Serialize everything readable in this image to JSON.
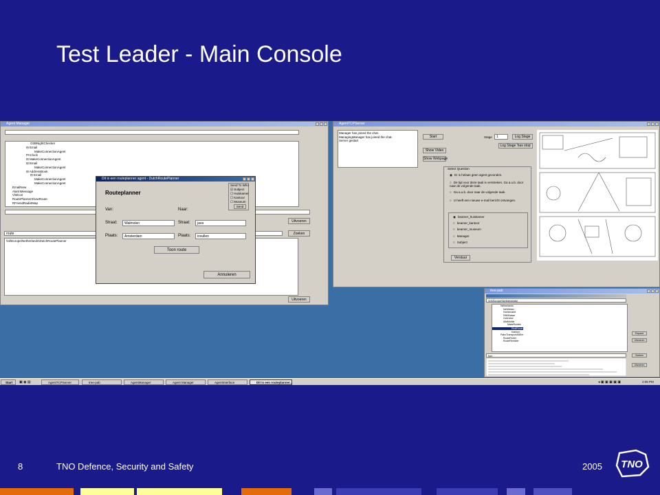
{
  "slide": {
    "title": "Test Leader - Main Console",
    "page_number": "8",
    "footer": "TNO Defence, Security and Safety",
    "year": "2005",
    "logo_text": "TNO"
  },
  "colors": {
    "background": "#1a1a8a",
    "desktop": "#3a6ea5",
    "strip": [
      "#e36c0a",
      "#ffff99",
      "#ffff99",
      "#e36c0a",
      "#6a6ad0",
      "#3c3cb4",
      "#3c3cb4",
      "#6a6ad0",
      "#5050c0"
    ]
  },
  "agent_manager": {
    "title": "Agent Manager",
    "tree": [
      "O2BNightChecker",
      "⊟ Email",
      "MakeConnectionAgent",
      "PAClock",
      "⊟ MakeConnectionAgent",
      "⊟ Email",
      "MakeConnectionAgent",
      "⊟ AddressBook",
      "⊟ Email",
      "MakeConnectionAgent",
      "MakeConnectionAgent",
      "EmailNew",
      "AlarmMessage",
      "VisEcar",
      "RoutePlannerShowRoute",
      "RFriendRadarMap"
    ],
    "route_input": "route",
    "result": "\\\\nl\\Europe\\Netherlands\\DutchRoutePlanner",
    "btn_uitvoeren": "Uitvoeren",
    "btn_zoeken": "Zoeken",
    "btn_uitvoeren2": "Uitvoeren"
  },
  "routeplanner": {
    "title": "Dit is een routeplanner agent - DutchRoutePlanner",
    "heading": "Routeplanner",
    "send_to_who": "Send To Who",
    "checks": [
      "Subject",
      "Huiskamer",
      "Kantoor",
      "Museum"
    ],
    "send": "Send",
    "van": "Van:",
    "naar": "Naar:",
    "straat": "Straat:",
    "plaats": "Plaats:",
    "van_straat": "Walmolen",
    "van_plaats": "Amsterdam",
    "naar_straat": "java",
    "naar_plaats": "invullen",
    "toon_route": "Toon route",
    "annuleren": "Annuleren"
  },
  "tcp_planner": {
    "title": "AgentTCPServer",
    "chat": [
      "Manager has joined the chat.",
      "ManagingManager has joined the chat.",
      "Server gestart"
    ],
    "start": "Start",
    "stage_label": "Stage",
    "stage_value": "1",
    "log_stage": "Log Stage",
    "log_stage_stop": "Log Stage 'has stop'",
    "show_video": "Show Video",
    "show_webpage": "Show Webpage",
    "select_question": "Select Question",
    "questions": [
      "Er is helaas geen agent gevonden.",
      "De tijd voor deze taak is verstreken. Ga a.u.b. door naar de volgende taak.",
      "Ga a.u.b. door naar de volgende taak.",
      "U heeft een nieuwe e-mail bericht ontvangen."
    ],
    "targets": [
      "beamer_huiskamer",
      "beamer_kantoor",
      "beamer_museum",
      "Manager",
      "Subject"
    ],
    "verstuur": "Verstuur"
  },
  "tree_panel": {
    "title": "tree-pab",
    "path": "\\\\nl\\Europe\\Netherlands\\",
    "items": [
      "Netherlands",
      "NetWeken",
      "Homemarkt",
      "PABKlasse",
      "Overview",
      "AlfaMobile",
      "MakeRoutes",
      "RealRoute",
      "Kantoor",
      "PatroTransportABEer",
      "RouteFinder",
      "RouteRemider"
    ],
    "expand": "Expand",
    "uitvoeren": "Uitvoeren",
    "zoeken": "Zoeken",
    "uitvoeren2": "Uitvoeren",
    "search_value": "fym"
  },
  "taskbar": {
    "start": "Start",
    "items": [
      "AgentTCPServer",
      "tree-pab",
      "AgentManager",
      "Agent Manager",
      "AgentInterface",
      "Dit is een routeplanner..."
    ],
    "clock": "2:05 PM"
  }
}
